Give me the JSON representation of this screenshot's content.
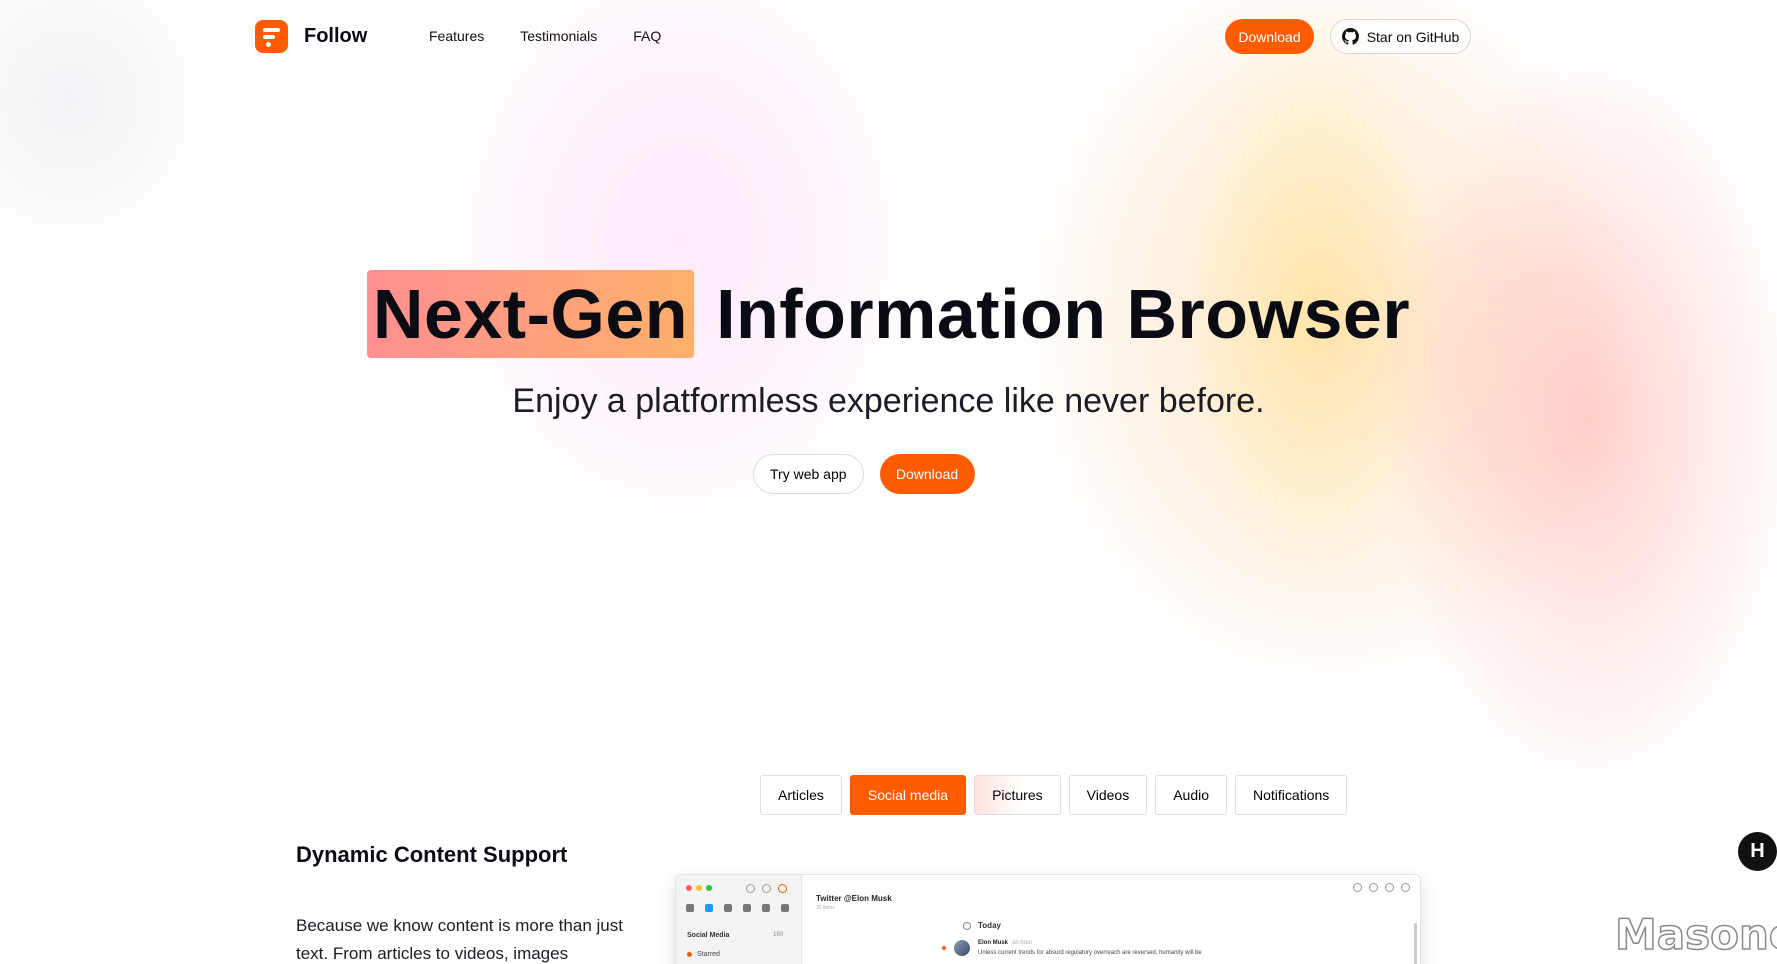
{
  "brand": {
    "name": "Follow",
    "accent": "#ff5c00"
  },
  "nav": {
    "links": [
      "Features",
      "Testimonials",
      "FAQ"
    ],
    "download_label": "Download",
    "github_label": "Star on GitHub"
  },
  "hero": {
    "highlight": "Next-Gen",
    "title_rest": "Information Browser",
    "subtitle": "Enjoy a platformless experience like never before.",
    "try_label": "Try web app",
    "download_label": "Download"
  },
  "tabs": {
    "items": [
      "Articles",
      "Social media",
      "Pictures",
      "Videos",
      "Audio",
      "Notifications"
    ],
    "active": "Social media"
  },
  "section": {
    "title": "Dynamic Content Support",
    "body": "Because we know content is more than just text. From articles to videos, images"
  },
  "mock": {
    "sidebar_label": "Social Media",
    "sidebar_count": "190",
    "starred_label": "Starred",
    "feed_title": "Twitter @Elon Musk",
    "feed_meta": "20 items",
    "today_label": "Today",
    "post_author": "Elon Musk",
    "post_time": "an hour",
    "post_body": "Unless current trends for absurd regulatory overreach are reversed, humanity will be"
  },
  "floating_badge": "H",
  "watermark": "Masone"
}
